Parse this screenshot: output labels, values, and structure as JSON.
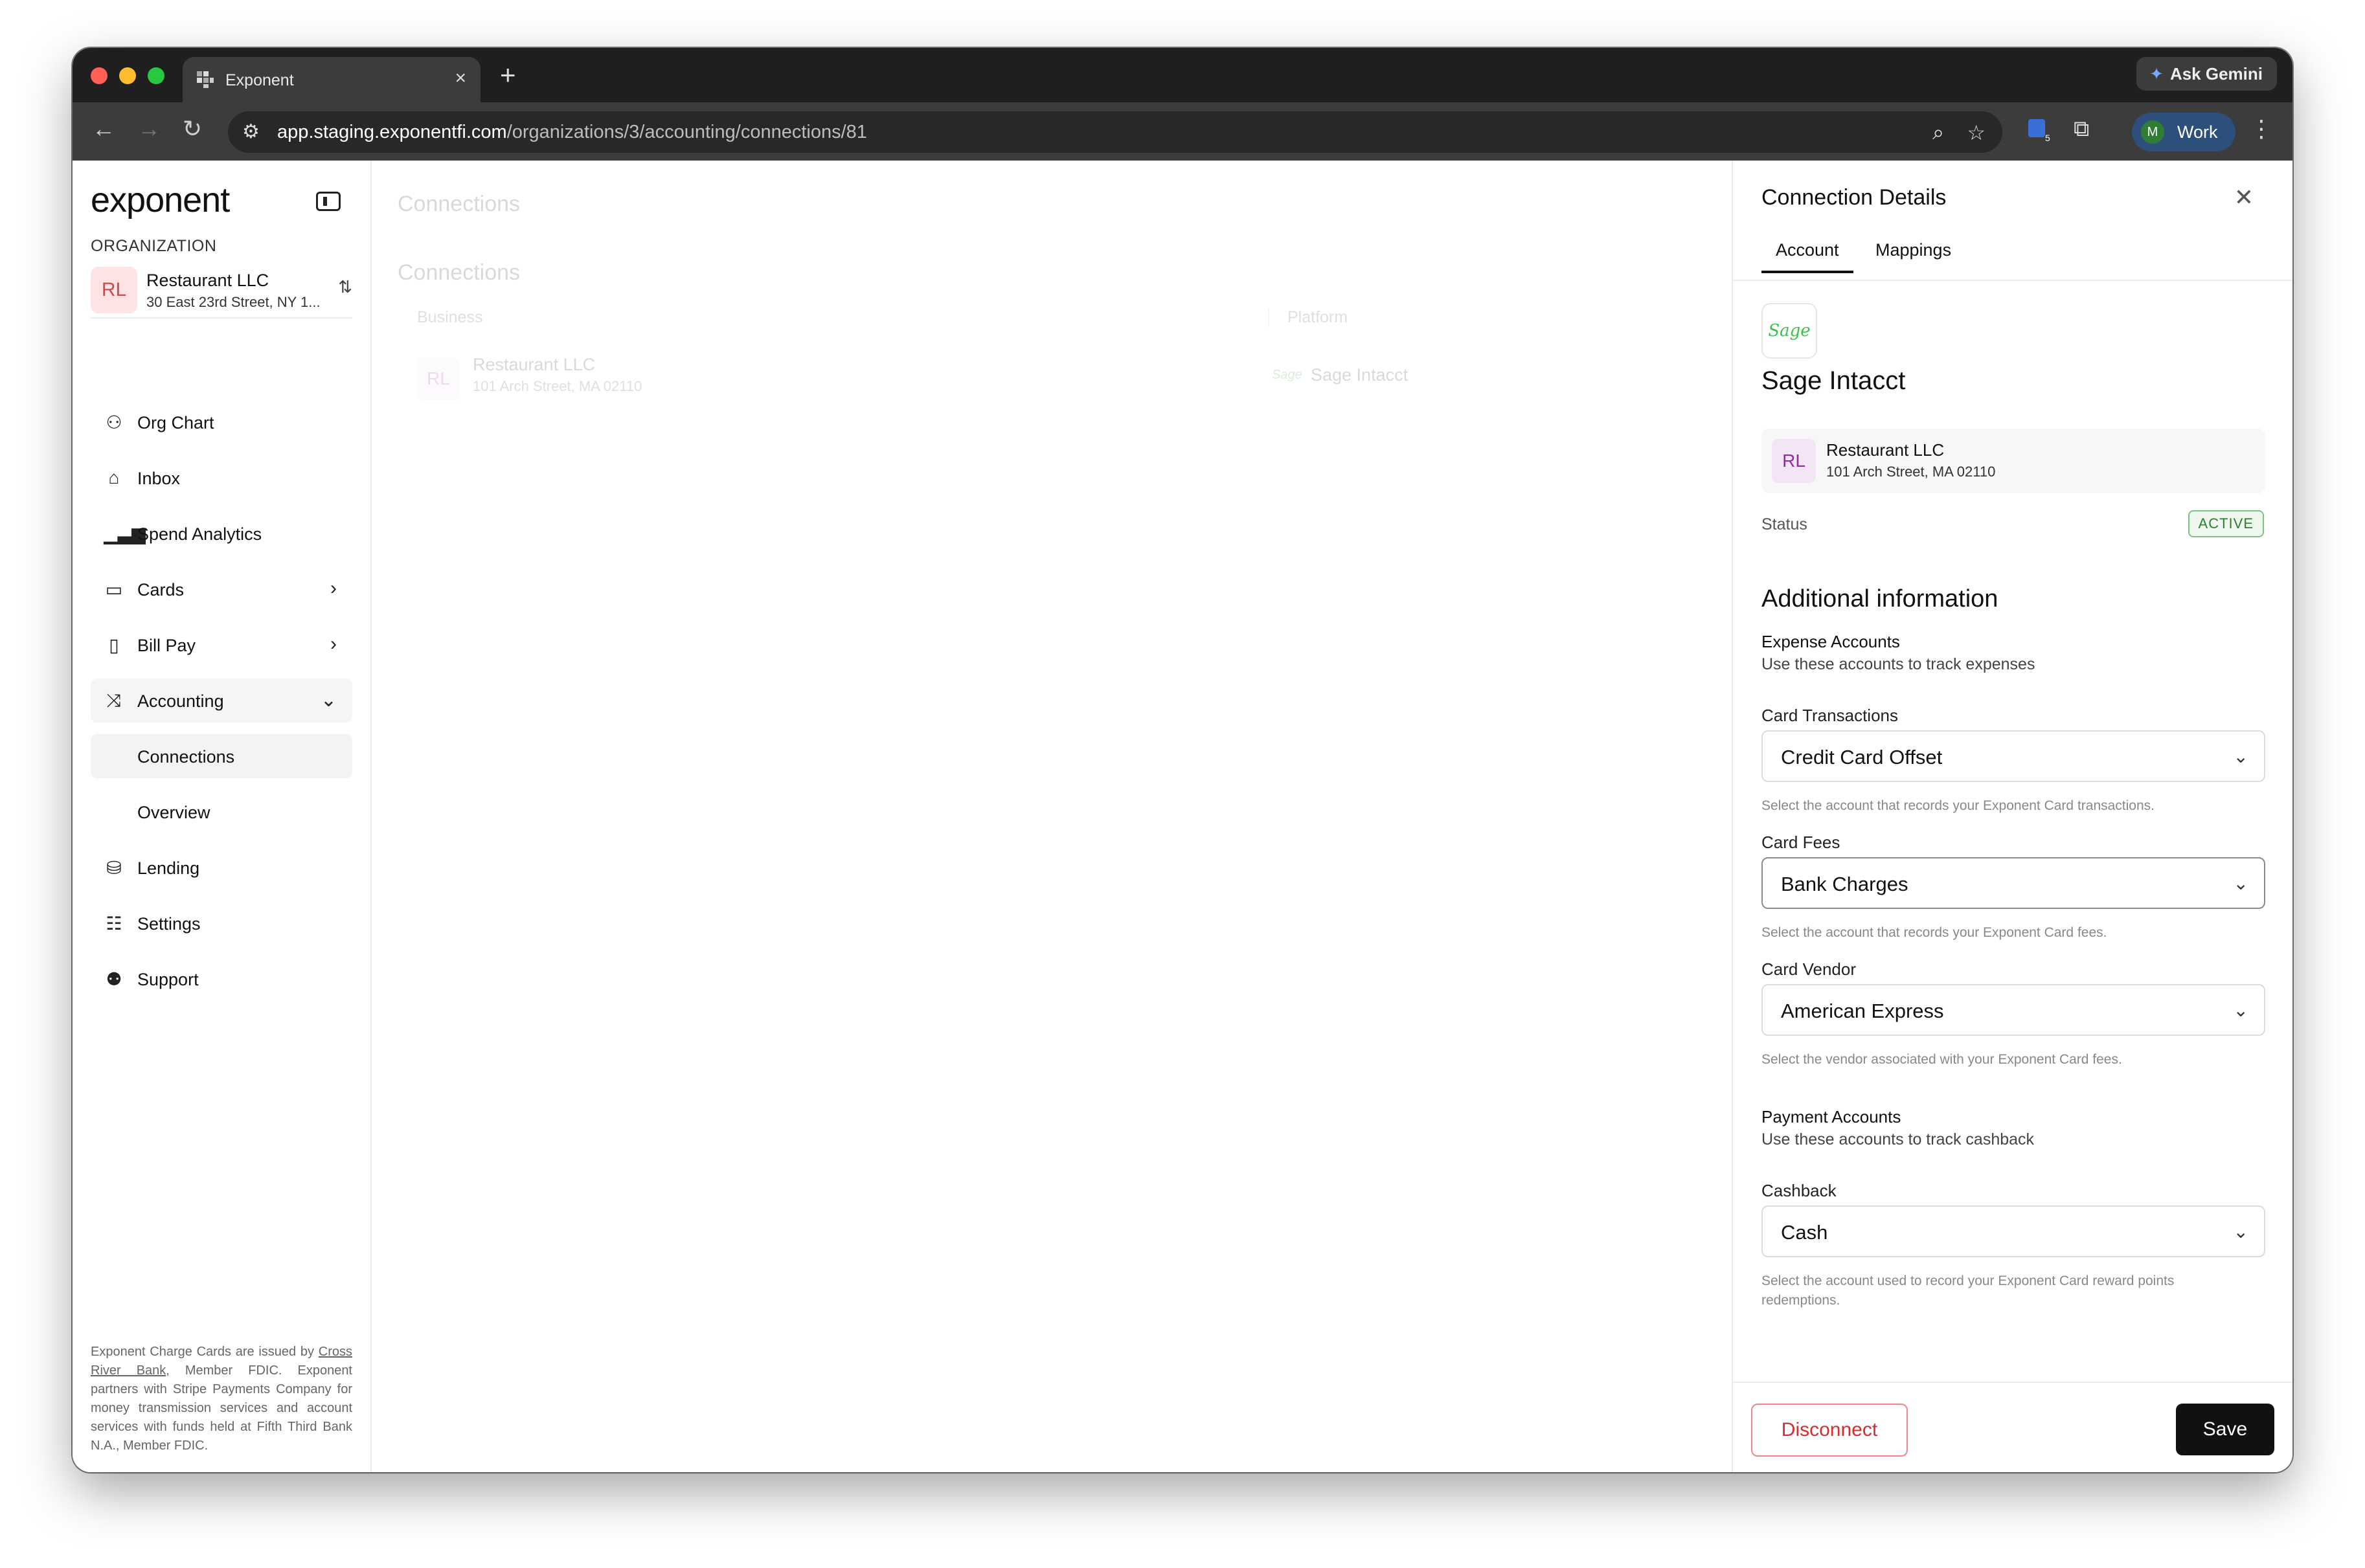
{
  "browser": {
    "tab_title": "Exponent",
    "new_tab": "+",
    "tab_close": "×",
    "gemini_label": "Ask Gemini",
    "url_host": "app.staging.exponentfi.com",
    "url_path": "/organizations/3/accounting/connections/81",
    "profile_label": "Work",
    "profile_initial": "M",
    "extension_badge": "5"
  },
  "sidebar": {
    "logo": "exponent",
    "org_label": "ORGANIZATION",
    "org": {
      "initials": "RL",
      "name": "Restaurant LLC",
      "address": "30 East 23rd Street, NY 1..."
    },
    "items": [
      {
        "label": "Org Chart"
      },
      {
        "label": "Inbox"
      },
      {
        "label": "Spend Analytics"
      },
      {
        "label": "Cards"
      },
      {
        "label": "Bill Pay"
      },
      {
        "label": "Accounting"
      },
      {
        "label": "Connections"
      },
      {
        "label": "Overview"
      },
      {
        "label": "Lending"
      },
      {
        "label": "Settings"
      },
      {
        "label": "Support"
      }
    ],
    "footnote_pre": "Exponent Charge Cards are issued by ",
    "footnote_link": "Cross River Bank",
    "footnote_post": ", Member FDIC. Exponent partners with Stripe Payments Company for money transmission services and account services with funds held at Fifth Third Bank N.A., Member FDIC."
  },
  "main": {
    "title": "Connections",
    "subtitle": "Connections",
    "columns": {
      "business": "Business",
      "platform": "Platform"
    },
    "row": {
      "initials": "RL",
      "name": "Restaurant LLC",
      "address": "101 Arch Street, MA 02110",
      "platform_logo": "Sage",
      "platform": "Sage Intacct"
    }
  },
  "drawer": {
    "title": "Connection Details",
    "tabs": [
      {
        "label": "Account"
      },
      {
        "label": "Mappings"
      }
    ],
    "platform_logo": "Sage",
    "platform_name": "Sage Intacct",
    "business": {
      "initials": "RL",
      "name": "Restaurant LLC",
      "address": "101 Arch Street, MA 02110"
    },
    "status_label": "Status",
    "status_value": "ACTIVE",
    "section_title": "Additional information",
    "expense": {
      "title": "Expense Accounts",
      "desc": "Use these accounts to track expenses"
    },
    "fields": [
      {
        "label": "Card Transactions",
        "value": "Credit Card Offset",
        "hint": "Select the account that records your Exponent Card transactions."
      },
      {
        "label": "Card Fees",
        "value": "Bank Charges",
        "hint": "Select the account that records your Exponent Card fees."
      },
      {
        "label": "Card Vendor",
        "value": "American Express",
        "hint": "Select the vendor associated with your Exponent Card fees."
      }
    ],
    "payment": {
      "title": "Payment Accounts",
      "desc": "Use these accounts to track cashback"
    },
    "cashback": {
      "label": "Cashback",
      "value": "Cash",
      "hint": "Select the account used to record your Exponent Card reward points redemptions."
    },
    "disconnect_label": "Disconnect",
    "save_label": "Save"
  },
  "colors": {
    "accent": "#111111",
    "danger": "#d32f2f",
    "success": "#2e7d32",
    "sage_green": "#3ec14b"
  }
}
